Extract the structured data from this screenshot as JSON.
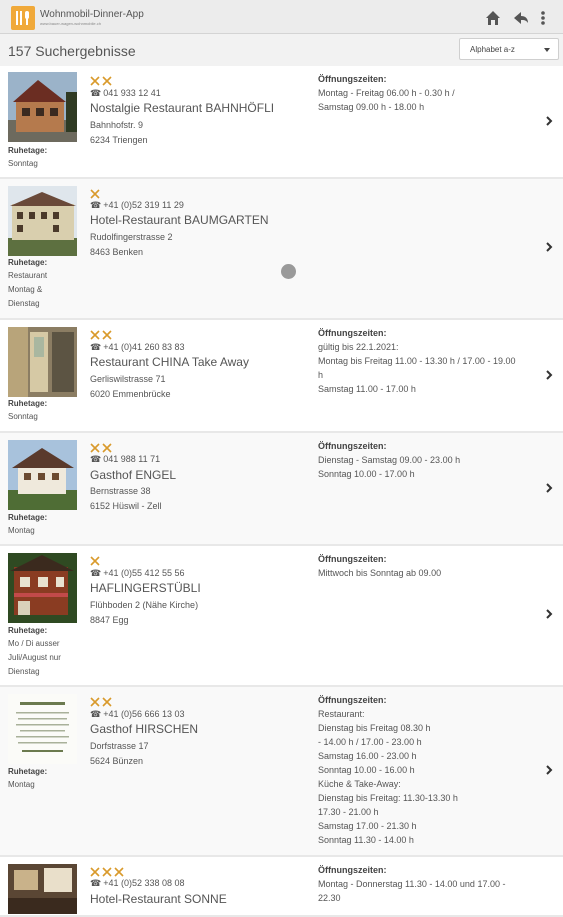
{
  "app": {
    "title": "Wohnmobil-Dinner-App",
    "subtitle": "www.bauer-wagen-wohnmobile.ch",
    "icons": [
      "home-icon",
      "back-arrow-icon",
      "more-vert-icon"
    ]
  },
  "results": {
    "count_label": "157 Suchergebnisse",
    "sort_value": "Alphabet a-z"
  },
  "labels": {
    "ruhetage": "Ruhetage:",
    "hours": "Öffnungszeiten:"
  },
  "colors": {
    "fork": "#d99a2b",
    "logo": "#f0a93a"
  },
  "items": [
    {
      "stars": 2,
      "phone": "041 933 12 41",
      "name": "Nostalgie Restaurant BAHNHÖFLI",
      "street": "Bahnhofstr. 9",
      "city": "6234 Triengen",
      "ruhetage": [
        "Sonntag"
      ],
      "hours_label": "Öffnungszeiten:",
      "hours": [
        "Montag - Freitag 06.00 h - 0.30 h /",
        "Samstag 09.00 h - 18.00 h"
      ]
    },
    {
      "stars": 1,
      "phone": "+41 (0)52 319 11 29",
      "name": "Hotel-Restaurant BAUMGARTEN",
      "street": "Rudolfingerstrasse 2",
      "city": "8463 Benken",
      "ruhetage": [
        "Restaurant",
        "Montag &",
        "Dienstag"
      ],
      "hours_label": "",
      "hours": []
    },
    {
      "stars": 2,
      "phone": "+41 (0)41 260 83 83",
      "name": "Restaurant CHINA Take Away",
      "street": "Gerliswilstrasse 71",
      "city": "6020 Emmenbrücke",
      "ruhetage": [
        "Sonntag"
      ],
      "hours_label": "Öffnungszeiten:",
      "hours": [
        "gültig bis 22.1.2021:",
        "Montag bis Freitag 11.00 - 13.30 h / 17.00 - 19.00",
        "h",
        "Samstag 11.00 - 17.00 h"
      ]
    },
    {
      "stars": 2,
      "phone": "041 988 11 71",
      "name": "Gasthof ENGEL",
      "street": "Bernstrasse 38",
      "city": "6152 Hüswil - Zell",
      "ruhetage": [
        "Montag"
      ],
      "hours_label": "Öffnungszeiten:",
      "hours": [
        "Dienstag - Samstag 09.00 - 23.00 h",
        "Sonntag 10.00 - 17.00 h"
      ]
    },
    {
      "stars": 1,
      "phone": "+41 (0)55 412 55 56",
      "name": "HAFLINGERSTÜBLI",
      "street": "Flühboden 2 (Nähe Kirche)",
      "city": "8847 Egg",
      "ruhetage": [
        "Mo / Di ausser",
        "Juli/August nur",
        "Dienstag"
      ],
      "hours_label": "Öffnungszeiten:",
      "hours": [
        "Mittwoch bis Sonntag ab 09.00"
      ]
    },
    {
      "stars": 2,
      "phone": "+41 (0)56 666 13 03",
      "name": "Gasthof HIRSCHEN",
      "street": "Dorfstrasse 17",
      "city": "5624 Bünzen",
      "ruhetage": [
        "Montag"
      ],
      "hours_label": "Öffnungszeiten:",
      "hours": [
        "Restaurant:",
        "Dienstag bis Freitag 08.30 h",
        "- 14.00 h / 17.00 - 23.00 h",
        "Samstag 16.00 - 23.00 h",
        "Sonntag 10.00 - 16.00 h",
        "Küche & Take-Away:",
        "Dienstag bis Freitag: 11.30-13.30 h",
        "17.30 - 21.00 h",
        "Samstag 17.00 - 21.30 h",
        "Sonntag 11.30 - 14.00 h"
      ]
    },
    {
      "stars": 3,
      "phone": "+41 (0)52 338 08 08",
      "name": "Hotel-Restaurant SONNE",
      "street": "",
      "city": "",
      "ruhetage": [],
      "hours_label": "Öffnungszeiten:",
      "hours": [
        "Montag - Donnerstag 11.30 - 14.00 und 17.00 -",
        "22.30"
      ]
    }
  ]
}
